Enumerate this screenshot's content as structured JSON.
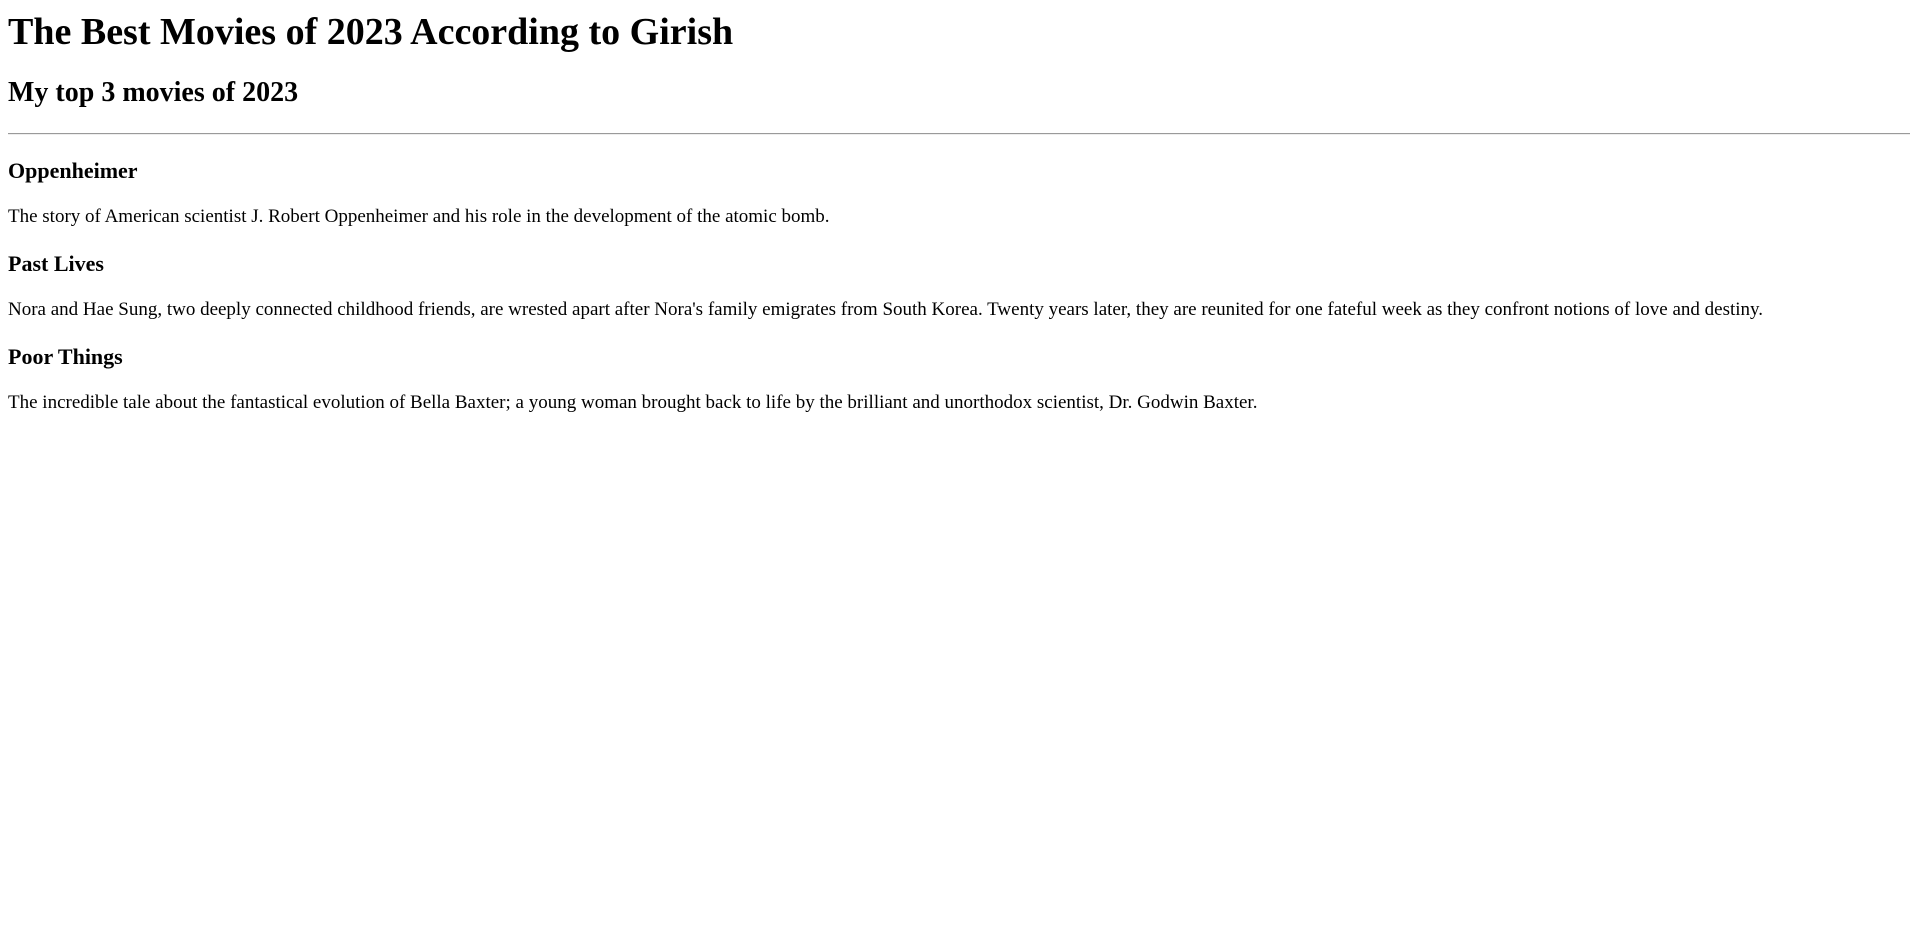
{
  "page": {
    "title": "The Best Movies of 2023 According to Girish",
    "subtitle": "My top 3 movies of 2023"
  },
  "movies": [
    {
      "title": "Oppenheimer",
      "description": "The story of American scientist J. Robert Oppenheimer and his role in the development of the atomic bomb."
    },
    {
      "title": "Past Lives",
      "description": "Nora and Hae Sung, two deeply connected childhood friends, are wrested apart after Nora's family emigrates from South Korea. Twenty years later, they are reunited for one fateful week as they confront notions of love and destiny."
    },
    {
      "title": "Poor Things",
      "description": "The incredible tale about the fantastical evolution of Bella Baxter; a young woman brought back to life by the brilliant and unorthodox scientist, Dr. Godwin Baxter."
    }
  ]
}
